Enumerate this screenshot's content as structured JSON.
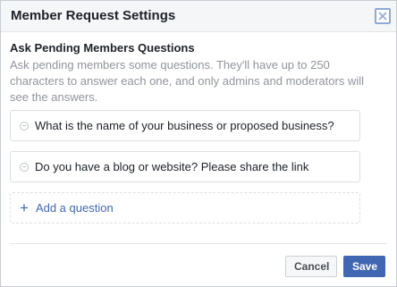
{
  "dialog": {
    "title": "Member Request Settings",
    "close_icon": "close-icon"
  },
  "section": {
    "title": "Ask Pending Members Questions",
    "description": "Ask pending members some questions. They'll have up to 250 characters to answer each one, and only admins and moderators will see the answers."
  },
  "questions": [
    {
      "text": "What is the name of your business or proposed business?",
      "icon": "remove-icon"
    },
    {
      "text": "Do you have a blog or website? Please share the link",
      "icon": "remove-icon"
    }
  ],
  "add_question": {
    "icon": "plus-icon",
    "label": "Add a question"
  },
  "footer": {
    "cancel_label": "Cancel",
    "save_label": "Save"
  },
  "colors": {
    "accent": "#4267b2",
    "text": "#1d2129",
    "muted": "#90949c",
    "border": "#dddfe2"
  }
}
